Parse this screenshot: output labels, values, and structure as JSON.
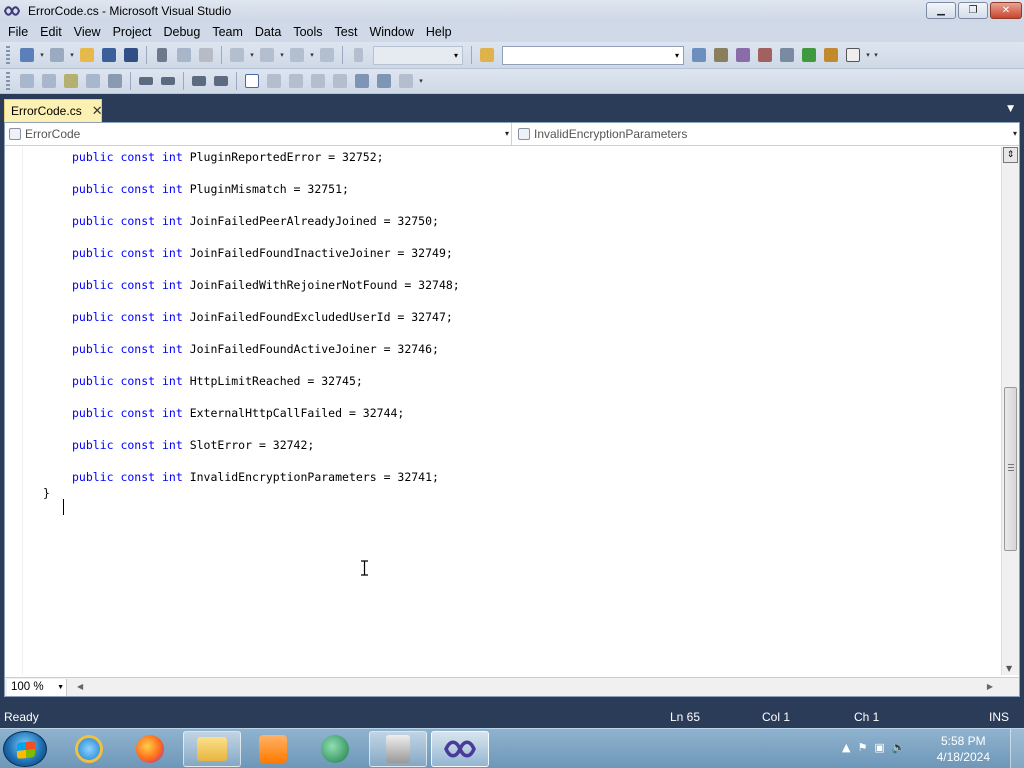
{
  "window": {
    "title": "ErrorCode.cs - Microsoft Visual Studio",
    "minimize": "▁",
    "restore": "❐",
    "close": "✕"
  },
  "menu": [
    "File",
    "Edit",
    "View",
    "Project",
    "Debug",
    "Team",
    "Data",
    "Tools",
    "Test",
    "Window",
    "Help"
  ],
  "tabs": {
    "active_label": "ErrorCode.cs",
    "close_glyph": "✕"
  },
  "navigation": {
    "type_label": "ErrorCode",
    "member_label": "InvalidEncryptionParameters"
  },
  "code": {
    "lines": [
      {
        "kw": "public const int",
        "text": " PluginReportedError = 32752;"
      },
      {
        "kw": "public const int",
        "text": " PluginMismatch = 32751;"
      },
      {
        "kw": "public const int",
        "text": " JoinFailedPeerAlreadyJoined = 32750;"
      },
      {
        "kw": "public const int",
        "text": " JoinFailedFoundInactiveJoiner = 32749;"
      },
      {
        "kw": "public const int",
        "text": " JoinFailedWithRejoinerNotFound = 32748;"
      },
      {
        "kw": "public const int",
        "text": " JoinFailedFoundExcludedUserId = 32747;"
      },
      {
        "kw": "public const int",
        "text": " JoinFailedFoundActiveJoiner = 32746;"
      },
      {
        "kw": "public const int",
        "text": " HttpLimitReached = 32745;"
      },
      {
        "kw": "public const int",
        "text": " ExternalHttpCallFailed = 32744;"
      },
      {
        "kw": "public const int",
        "text": " SlotError = 32742;"
      },
      {
        "kw": "public const int",
        "text": " InvalidEncryptionParameters = 32741;"
      }
    ],
    "closing_brace": "}"
  },
  "editor": {
    "zoom": "100 %"
  },
  "status": {
    "text": "Ready",
    "line": "Ln 65",
    "col": "Col 1",
    "ch": "Ch 1",
    "mode": "INS"
  },
  "taskbar": {
    "time": "5:58 PM",
    "date": "4/18/2024"
  },
  "colors": {
    "keyword": "#0000ff",
    "chrome": "#2b3c59",
    "active_tab": "#fcf0b2"
  }
}
